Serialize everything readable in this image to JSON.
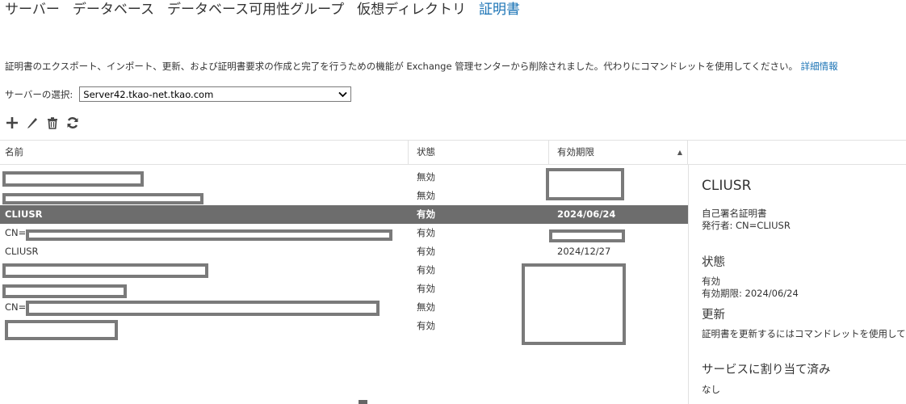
{
  "tabs": [
    {
      "label": "サーバー",
      "active": false
    },
    {
      "label": "データベース",
      "active": false
    },
    {
      "label": "データベース可用性グループ",
      "active": false
    },
    {
      "label": "仮想ディレクトリ",
      "active": false
    },
    {
      "label": "証明書",
      "active": true
    }
  ],
  "notice": {
    "text": "証明書のエクスポート、インポート、更新、および証明書要求の作成と完了を行うための機能が Exchange 管理センターから削除されました。代わりにコマンドレットを使用してください。",
    "link": "詳細情報"
  },
  "server_select": {
    "label": "サーバーの選択:",
    "value": "Server42.tkao-net.tkao.com"
  },
  "toolbar": {
    "icons": [
      "add-icon",
      "edit-icon",
      "delete-icon",
      "refresh-icon"
    ]
  },
  "grid": {
    "columns": {
      "name": "名前",
      "status": "状態",
      "expiration": "有効期限"
    },
    "sort_indicator": "▲",
    "rows": [
      {
        "name": "",
        "status": "無効",
        "expiration": ""
      },
      {
        "name": "",
        "status": "無効",
        "expiration": ""
      },
      {
        "name": "CLIUSR",
        "status": "有効",
        "expiration": "2024/06/24",
        "selected": true
      },
      {
        "name": "CN=",
        "status": "有効",
        "expiration": ""
      },
      {
        "name": "CLIUSR",
        "status": "有効",
        "expiration": "2024/12/27"
      },
      {
        "name": "",
        "status": "有効",
        "expiration": ""
      },
      {
        "name": "",
        "status": "有効",
        "expiration": ""
      },
      {
        "name": "CN=",
        "status": "無効",
        "expiration": ""
      },
      {
        "name": "",
        "status": "有効",
        "expiration": ""
      }
    ]
  },
  "detail": {
    "title": "CLIUSR",
    "cert_type": "自己署名証明書",
    "issuer": "発行者: CN=CLIUSR",
    "status_heading": "状態",
    "status_value": "有効",
    "expiration": "有効期限: 2024/06/24",
    "renew_heading": "更新",
    "renew_text": "証明書を更新するにはコマンドレットを使用してください",
    "services_heading": "サービスに割り当て済み",
    "services_value": "なし"
  },
  "colors": {
    "accent": "#1a73b5",
    "selected_row": "#6d6d6d",
    "redaction": "#7a7a7a"
  }
}
